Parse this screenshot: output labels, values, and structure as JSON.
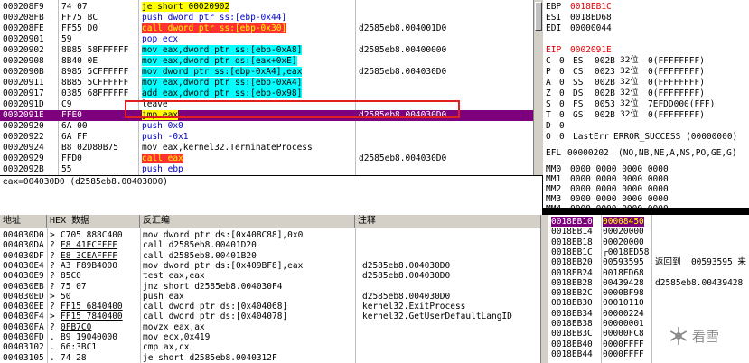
{
  "disasm": {
    "rows": [
      {
        "addr": "000208F9",
        "hex": "74 07",
        "asm": "je short 00020902",
        "cmt": "",
        "asm_bg": "yellow"
      },
      {
        "addr": "000208FB",
        "hex": "FF75 BC",
        "asm": "push dword ptr ss:[ebp-0x44]",
        "cmt": "",
        "asm_color": "blue"
      },
      {
        "addr": "000208FE",
        "hex": "FF55 D0",
        "asm": "call dword ptr ss:[ebp-0x30]",
        "cmt": "d2585eb8.004001D0",
        "asm_bg": "red"
      },
      {
        "addr": "00020901",
        "hex": "59",
        "asm": "pop ecx",
        "cmt": "",
        "asm_color": "blue"
      },
      {
        "addr": "00020902",
        "hex": "8B85 58FFFFFF",
        "asm": "mov eax,dword ptr ss:[ebp-0xA8]",
        "cmt": "d2585eb8.00400000",
        "asm_bg": "cyan"
      },
      {
        "addr": "00020908",
        "hex": "8B40 0E",
        "asm": "mov eax,dword ptr ds:[eax+0xE]",
        "cmt": "",
        "asm_bg": "cyan"
      },
      {
        "addr": "0002090B",
        "hex": "8985 5CFFFFFF",
        "asm": "mov dword ptr ss:[ebp-0xA4],eax",
        "cmt": "d2585eb8.004030D0",
        "asm_bg": "cyan"
      },
      {
        "addr": "00020911",
        "hex": "8B85 5CFFFFFF",
        "asm": "mov eax,dword ptr ss:[ebp-0xA4]",
        "cmt": "",
        "asm_bg": "cyan"
      },
      {
        "addr": "00020917",
        "hex": "0385 68FFFFFF",
        "asm": "add eax,dword ptr ss:[ebp-0x98]",
        "cmt": "",
        "asm_bg": "cyan"
      },
      {
        "addr": "0002091D",
        "hex": "C9",
        "asm": "leave",
        "cmt": ""
      },
      {
        "addr": "0002091E",
        "hex": "FFE0",
        "asm": "jmp eax",
        "cmt": "d2585eb8.004030D0",
        "selected": true
      },
      {
        "addr": "00020920",
        "hex": "6A 00",
        "asm": "push 0x0",
        "cmt": "",
        "asm_color": "blue"
      },
      {
        "addr": "00020922",
        "hex": "6A FF",
        "asm": "push -0x1",
        "cmt": "",
        "asm_color": "blue"
      },
      {
        "addr": "00020924",
        "hex": "B8 02D80B75",
        "asm": "mov eax,kernel32.TerminateProcess",
        "cmt": ""
      },
      {
        "addr": "00020929",
        "hex": "FFD0",
        "asm": "call eax",
        "cmt": "d2585eb8.004030D0",
        "asm_bg": "red"
      },
      {
        "addr": "0002092B",
        "hex": "55",
        "asm": "push ebp",
        "cmt": "",
        "asm_color": "blue"
      }
    ],
    "info_line": "eax=004030D0 (d2585eb8.004030D0)"
  },
  "registers": {
    "lines": [
      {
        "name": "EBP",
        "value": "0018EB1C",
        "hl": true
      },
      {
        "name": "ESI",
        "value": "0018ED68"
      },
      {
        "name": "EDI",
        "value": "00000044"
      },
      {
        "name": "",
        "value": ""
      },
      {
        "name": "EIP",
        "value": "0002091E",
        "eip": true
      },
      {
        "name": "",
        "value": ""
      }
    ],
    "flags": [
      {
        "f": "C",
        "v": "0",
        "seg": "ES",
        "sel": "002B",
        "bits": "32位",
        "range": "0(FFFFFFFF)"
      },
      {
        "f": "P",
        "v": "0",
        "seg": "CS",
        "sel": "0023",
        "bits": "32位",
        "range": "0(FFFFFFFF)"
      },
      {
        "f": "A",
        "v": "0",
        "seg": "SS",
        "sel": "002B",
        "bits": "32位",
        "range": "0(FFFFFFFF)"
      },
      {
        "f": "Z",
        "v": "0",
        "seg": "DS",
        "sel": "002B",
        "bits": "32位",
        "range": "0(FFFFFFFF)"
      },
      {
        "f": "S",
        "v": "0",
        "seg": "FS",
        "sel": "0053",
        "bits": "32位",
        "range": "7EFDD000(FFF)"
      },
      {
        "f": "T",
        "v": "0",
        "seg": "GS",
        "sel": "002B",
        "bits": "32位",
        "range": "0(FFFFFFFF)"
      },
      {
        "f": "D",
        "v": "0",
        "seg": "",
        "sel": "",
        "bits": "",
        "range": ""
      },
      {
        "f": "O",
        "v": "0",
        "seg": "LastErr",
        "sel": "",
        "bits": "",
        "range": "ERROR_SUCCESS (00000000)"
      }
    ],
    "efl": {
      "label": "EFL",
      "value": "00000202",
      "desc": "(NO,NB,NE,A,NS,PO,GE,G)"
    },
    "mm": [
      {
        "name": "MM0",
        "value": "0000 0000 0000 0000"
      },
      {
        "name": "MM1",
        "value": "0000 0000 0000 0000"
      },
      {
        "name": "MM2",
        "value": "0000 0000 0000 0000"
      },
      {
        "name": "MM3",
        "value": "0000 0000 0000 0000"
      },
      {
        "name": "MM4",
        "value": "0000 0000 0000 0000"
      }
    ]
  },
  "dump": {
    "headers": {
      "addr": "地址",
      "hex": "HEX 数据",
      "asm": "反汇编",
      "cmt": "注释"
    },
    "rows": [
      {
        "addr": "004030D0",
        "m": ">",
        "hex": "C705 888C400",
        "asm": "mov dword ptr ds:[0x408C88],0x0",
        "cmt": ""
      },
      {
        "addr": "004030DA",
        "m": "?",
        "hex": "E8 41ECFFFF",
        "asm": "call d2585eb8.00401D20",
        "cmt": "",
        "ul": true
      },
      {
        "addr": "004030DF",
        "m": "?",
        "hex": "E8 3CEAFFFF",
        "asm": "call d2585eb8.00401B20",
        "cmt": "",
        "ul": true
      },
      {
        "addr": "004030E4",
        "m": "?",
        "hex": "A3 F89B4000",
        "asm": "mov dword ptr ds:[0x409BF8],eax",
        "cmt": "d2585eb8.004030D0"
      },
      {
        "addr": "004030E9",
        "m": "?",
        "hex": "85C0",
        "asm": "test eax,eax",
        "cmt": "d2585eb8.004030D0"
      },
      {
        "addr": "004030EB",
        "m": "?",
        "hex": "75 07",
        "asm": "jnz short d2585eb8.004030F4",
        "cmt": ""
      },
      {
        "addr": "004030ED",
        "m": ">",
        "hex": "50",
        "asm": "push eax",
        "cmt": "d2585eb8.004030D0"
      },
      {
        "addr": "004030EE",
        "m": "?",
        "hex": "FF15 6840400",
        "asm": "call dword ptr ds:[0x404068]",
        "cmt": "kernel32.ExitProcess",
        "ul": true
      },
      {
        "addr": "004030F4",
        "m": ">",
        "hex": "FF15 7840400",
        "asm": "call dword ptr ds:[0x404078]",
        "cmt": "kernel32.GetUserDefaultLangID",
        "ul": true
      },
      {
        "addr": "004030FA",
        "m": "?",
        "hex": "0FB7C0",
        "asm": "movzx eax,ax",
        "cmt": "",
        "ul": true
      },
      {
        "addr": "004030FD",
        "m": ".",
        "hex": "B9 19040000",
        "asm": "mov ecx,0x419",
        "cmt": ""
      },
      {
        "addr": "00403102",
        "m": ".",
        "hex": "66:3BC1",
        "asm": "cmp ax,cx",
        "cmt": ""
      },
      {
        "addr": "00403105",
        "m": ".",
        "hex": "74 28",
        "asm": "je short d2585eb8.0040312F",
        "cmt": ""
      }
    ]
  },
  "stack": {
    "rows": [
      {
        "addr": "0018EB10",
        "value": "00008450",
        "cmt": "",
        "sel": true
      },
      {
        "addr": "0018EB14",
        "value": "00020000",
        "cmt": ""
      },
      {
        "addr": "0018EB18",
        "value": "00020000",
        "cmt": ""
      },
      {
        "addr": "0018EB1C",
        "value": "┌0018ED58",
        "cmt": ""
      },
      {
        "addr": "0018EB20",
        "value": "00593595",
        "cmt": "返回到  00593595 来"
      },
      {
        "addr": "0018EB24",
        "value": "0018ED68",
        "cmt": ""
      },
      {
        "addr": "0018EB28",
        "value": "00439428",
        "cmt": "d2585eb8.00439428"
      },
      {
        "addr": "0018EB2C",
        "value": "0000BF98",
        "cmt": ""
      },
      {
        "addr": "0018EB30",
        "value": "00010110",
        "cmt": ""
      },
      {
        "addr": "0018EB34",
        "value": "00000224",
        "cmt": ""
      },
      {
        "addr": "0018EB38",
        "value": "00000001",
        "cmt": ""
      },
      {
        "addr": "0018EB3C",
        "value": "00000FC8",
        "cmt": ""
      },
      {
        "addr": "0018EB40",
        "value": "0000FFFF",
        "cmt": ""
      },
      {
        "addr": "0018EB44",
        "value": "0000FFFF",
        "cmt": ""
      }
    ]
  },
  "watermark": {
    "text": "看雪"
  }
}
